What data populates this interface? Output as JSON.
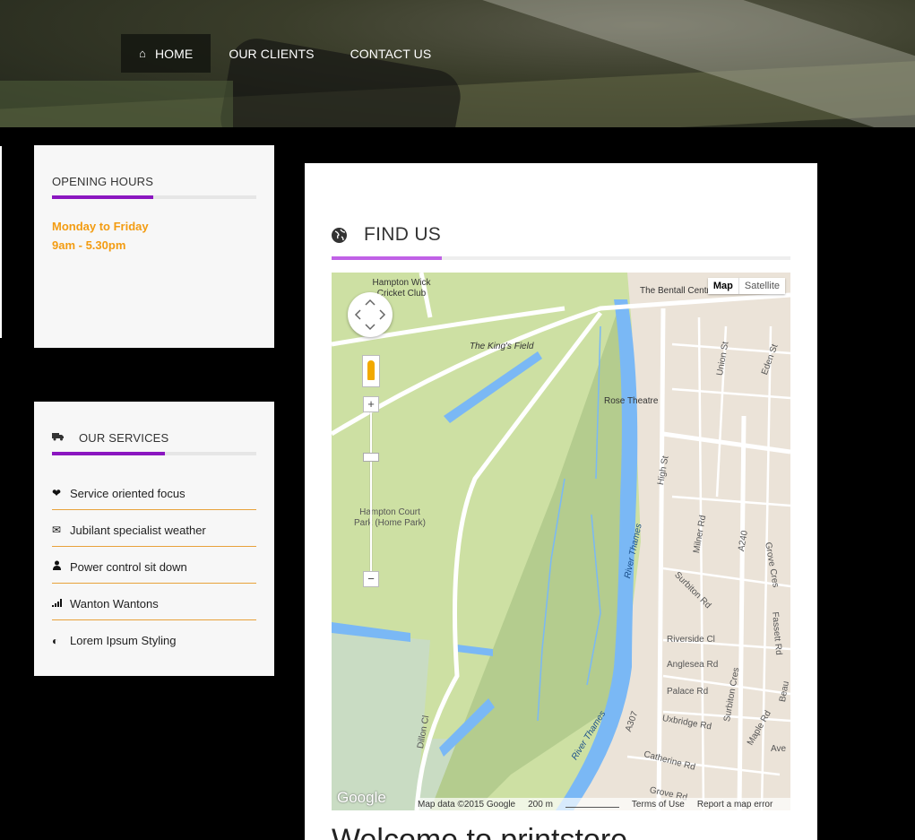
{
  "nav": {
    "items": [
      {
        "label": "HOME",
        "icon": "home-icon",
        "active": true
      },
      {
        "label": "OUR CLIENTS"
      },
      {
        "label": "CONTACT US"
      }
    ]
  },
  "opening_hours": {
    "title": "OPENING HOURS",
    "days": "Monday to Friday",
    "hours": "9am - 5.30pm"
  },
  "services": {
    "title": "OUR SERVICES",
    "title_icon": "truck-icon",
    "items": [
      {
        "label": "Service oriented focus",
        "icon": "heart-icon"
      },
      {
        "label": "Jubilant specialist weather",
        "icon": "envelope-icon"
      },
      {
        "label": "Power control sit down",
        "icon": "user-icon"
      },
      {
        "label": "Wanton Wantons",
        "icon": "signal-icon"
      },
      {
        "label": "Lorem Ipsum Styling",
        "icon": "contrast-icon"
      }
    ]
  },
  "find_us": {
    "title": "FIND US",
    "icon": "globe-icon"
  },
  "map": {
    "map_type_selected": "Map",
    "map_type_other": "Satellite",
    "labels": {
      "cricket_club": "Hampton Wick Cricket Club",
      "kings_field": "The King's Field",
      "bentall": "The Bentall Centre",
      "rose_theatre": "Rose Theatre",
      "park": "Hampton Court Park (Home Park)",
      "river": "River Thames",
      "high_st": "High St",
      "a240": "A240",
      "surbiton_rd": "Surbiton Rd",
      "riverside_cl": "Riverside Cl",
      "anglesea_rd": "Anglesea Rd",
      "palace_rd": "Palace Rd",
      "uxbridge_rd": "Uxbridge Rd",
      "catherine_rd": "Catherine Rd",
      "grove": "Grove Rd",
      "dillon_cl": "Dillon Cl",
      "a307": "A307",
      "milner_rd": "Milner Rd",
      "union_st": "Union St",
      "eden_st": "Eden St",
      "surbiton_cres": "Surbiton Cres",
      "grove_cres": "Grove Cres",
      "fassett_rd": "Fassett Rd",
      "maple_rd": "Maple Rd",
      "ave": "Ave",
      "beaufort": "Beau"
    },
    "logo": "Google",
    "attribution": "Map data ©2015 Google",
    "scale": "200 m",
    "terms": "Terms of Use",
    "report": "Report a map error"
  },
  "welcome": {
    "heading": "Welcome to printstore"
  },
  "colors": {
    "accent_purple": "#8b16c0",
    "findus_purple": "#c061e6",
    "orange": "#f39c12",
    "water": "#7ab8f5",
    "park": "#cde0a3",
    "urban": "#ece4dc"
  }
}
